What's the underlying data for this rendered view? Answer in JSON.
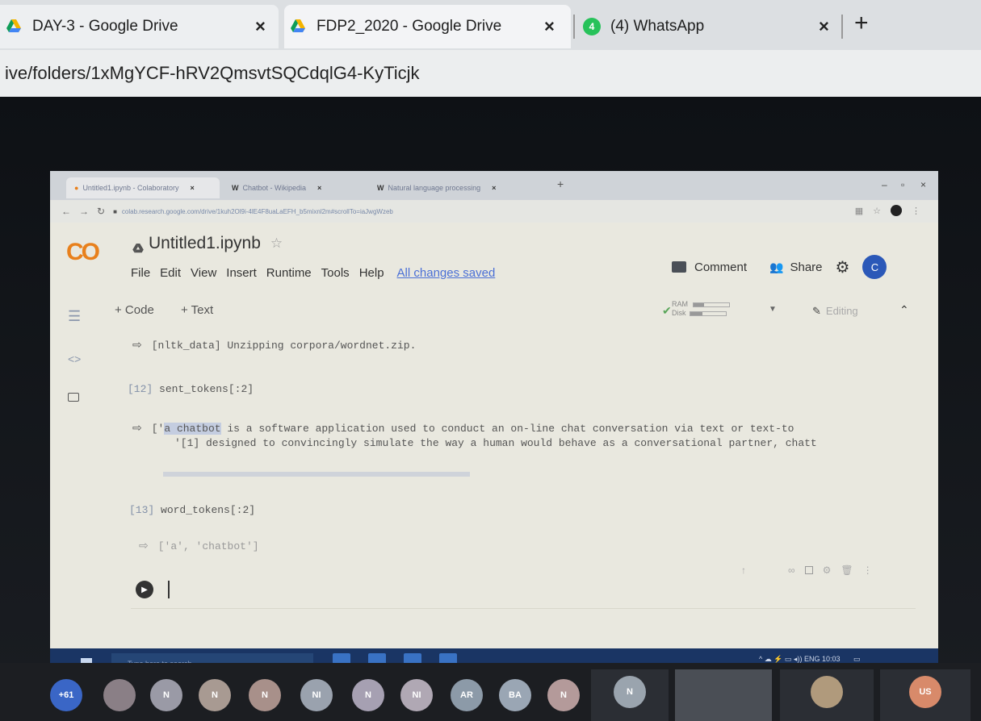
{
  "outer_browser": {
    "tabs": [
      {
        "label": "DAY-3 - Google Drive",
        "close": "×"
      },
      {
        "label": "FDP2_2020 - Google Drive",
        "close": "×"
      },
      {
        "label": "(4) WhatsApp",
        "close": "×",
        "badge": "4"
      }
    ],
    "new_tab": "+",
    "url": "ive/folders/1xMgYCF-hRV2QmsvtSQCdqlG4-KyTicjk"
  },
  "inner_browser": {
    "tabs": [
      {
        "label": "Untitled1.ipynb - Colaboratory",
        "close": "×"
      },
      {
        "label": "Chatbot - Wikipedia",
        "close": "×"
      },
      {
        "label": "Natural language processing",
        "close": "×"
      }
    ],
    "url": "colab.research.google.com/drive/1kuh2Ol9i-4lE4F8uaLaEFH_b5mixnl2m#scrollTo=iaJwgWzeb"
  },
  "colab": {
    "logo": "CO",
    "notebook_title": "Untitled1.ipynb",
    "menu": [
      "File",
      "Edit",
      "View",
      "Insert",
      "Runtime",
      "Tools",
      "Help"
    ],
    "save_status": "All changes saved",
    "comment_label": "Comment",
    "share_label": "Share",
    "avatar_initial": "C",
    "add_code": "+ Code",
    "add_text": "+ Text",
    "ram_label": "RAM",
    "disk_label": "Disk",
    "ram_usage": 0.3,
    "disk_usage": 0.35,
    "editing_label": "Editing"
  },
  "cells": {
    "out0": "[nltk_data]   Unzipping corpora/wordnet.zip.",
    "cell12_exec": "[12]",
    "cell12_code": "sent_tokens[:2]",
    "cell12_out_prefix": "['",
    "cell12_out_highlight": "a chatbot",
    "cell12_out_line1": " is a software application used to conduct an on-line chat conversation via text or text-to",
    "cell12_out_line2": "'[1] designed to convincingly simulate the way a human would behave as a conversational partner, chatt",
    "cell13_exec": "[13]",
    "cell13_code": "word_tokens[:2]",
    "cell13_out": "['a', 'chatbot']"
  },
  "taskbar": {
    "search_placeholder": "Type here to search",
    "tray_time": "10:03"
  },
  "participants": [
    "+61",
    "N",
    "N",
    "N",
    "NI",
    "N",
    "NI",
    "AR",
    "BA",
    "N",
    "N",
    "US"
  ],
  "colors": {
    "colab_orange": "#e8801c",
    "avatar_blue": "#2b58b8",
    "whatsapp_green": "#27c25a",
    "taskbar_blue": "#1a3564"
  }
}
